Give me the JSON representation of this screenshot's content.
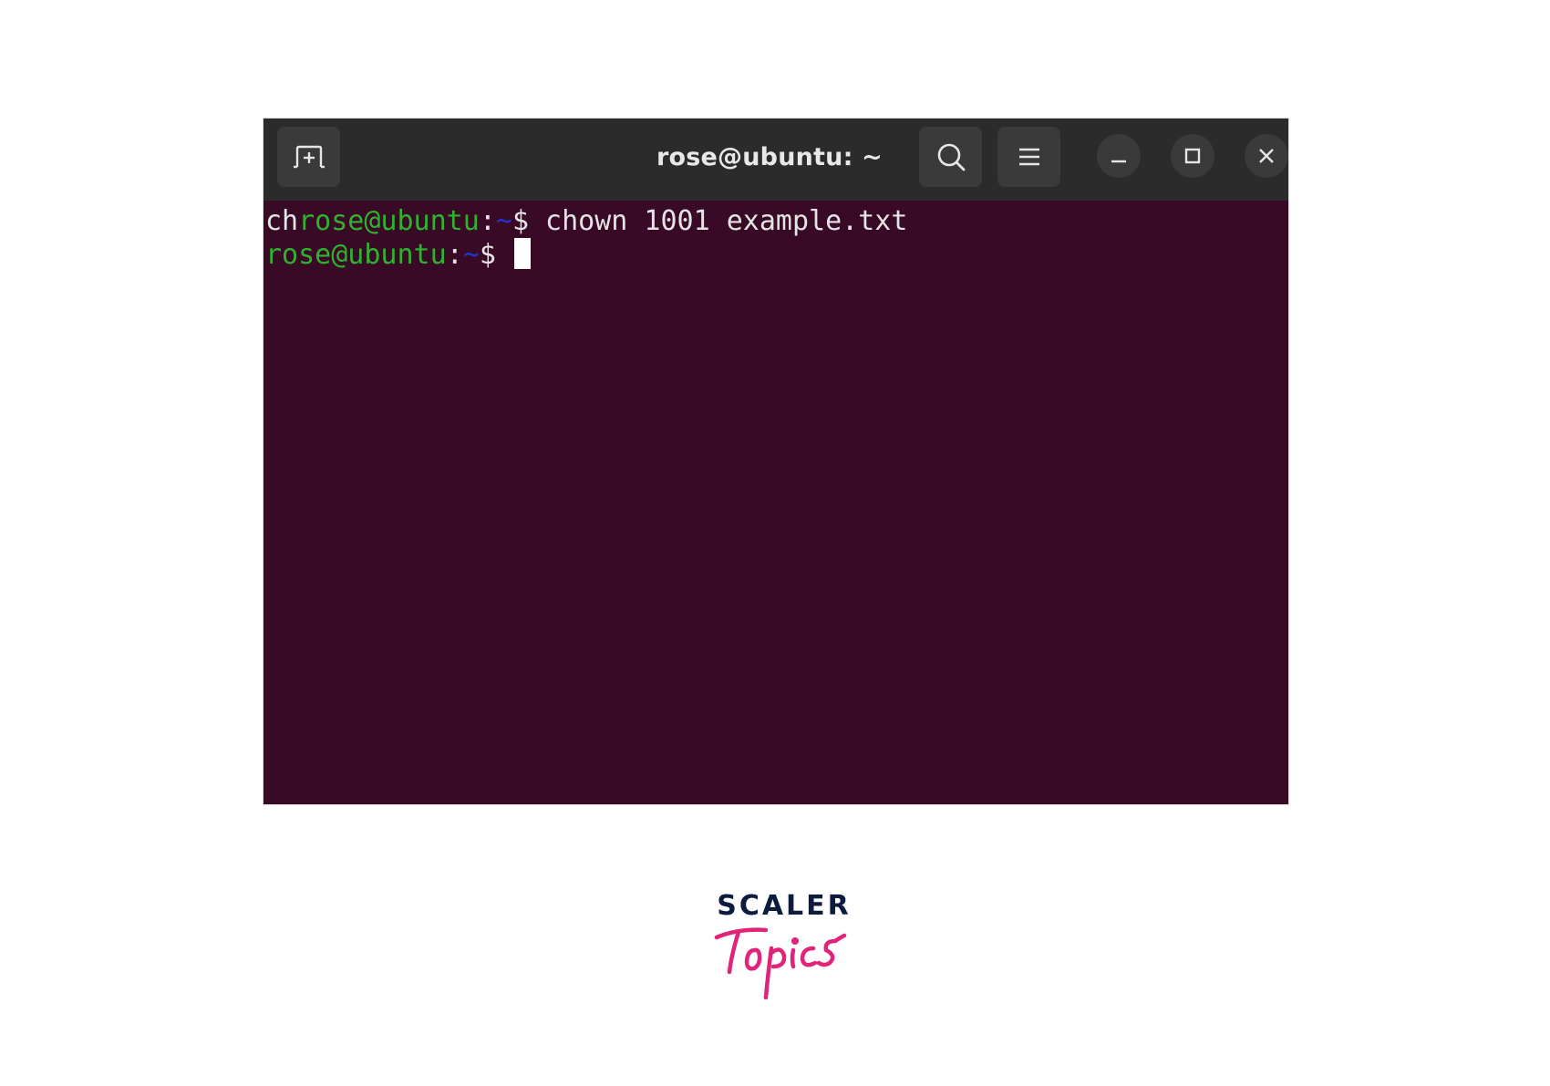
{
  "window": {
    "title": "rose@ubuntu: ~"
  },
  "terminal": {
    "line1": {
      "prefix": "ch",
      "user_host": "rose@ubuntu",
      "colon": ":",
      "path": "~",
      "dollar": "$",
      "command": " chown 1001 example.txt"
    },
    "line2": {
      "user_host": "rose@ubuntu",
      "colon": ":",
      "path": "~",
      "dollar": "$ "
    }
  },
  "icons": {
    "new_tab": "new-tab-icon",
    "search": "search-icon",
    "menu": "hamburger-menu-icon",
    "minimize": "minimize-icon",
    "maximize": "maximize-icon",
    "close": "close-icon"
  },
  "colors": {
    "terminal_bg": "#380a26",
    "titlebar_bg": "#2b2b2b",
    "prompt_user": "#2fb32f",
    "prompt_path": "#1d35c9",
    "logo_dark": "#0d1b3e",
    "logo_pink": "#e0247a"
  },
  "logo": {
    "top_word": "SCALER",
    "script_word": "Topics"
  }
}
